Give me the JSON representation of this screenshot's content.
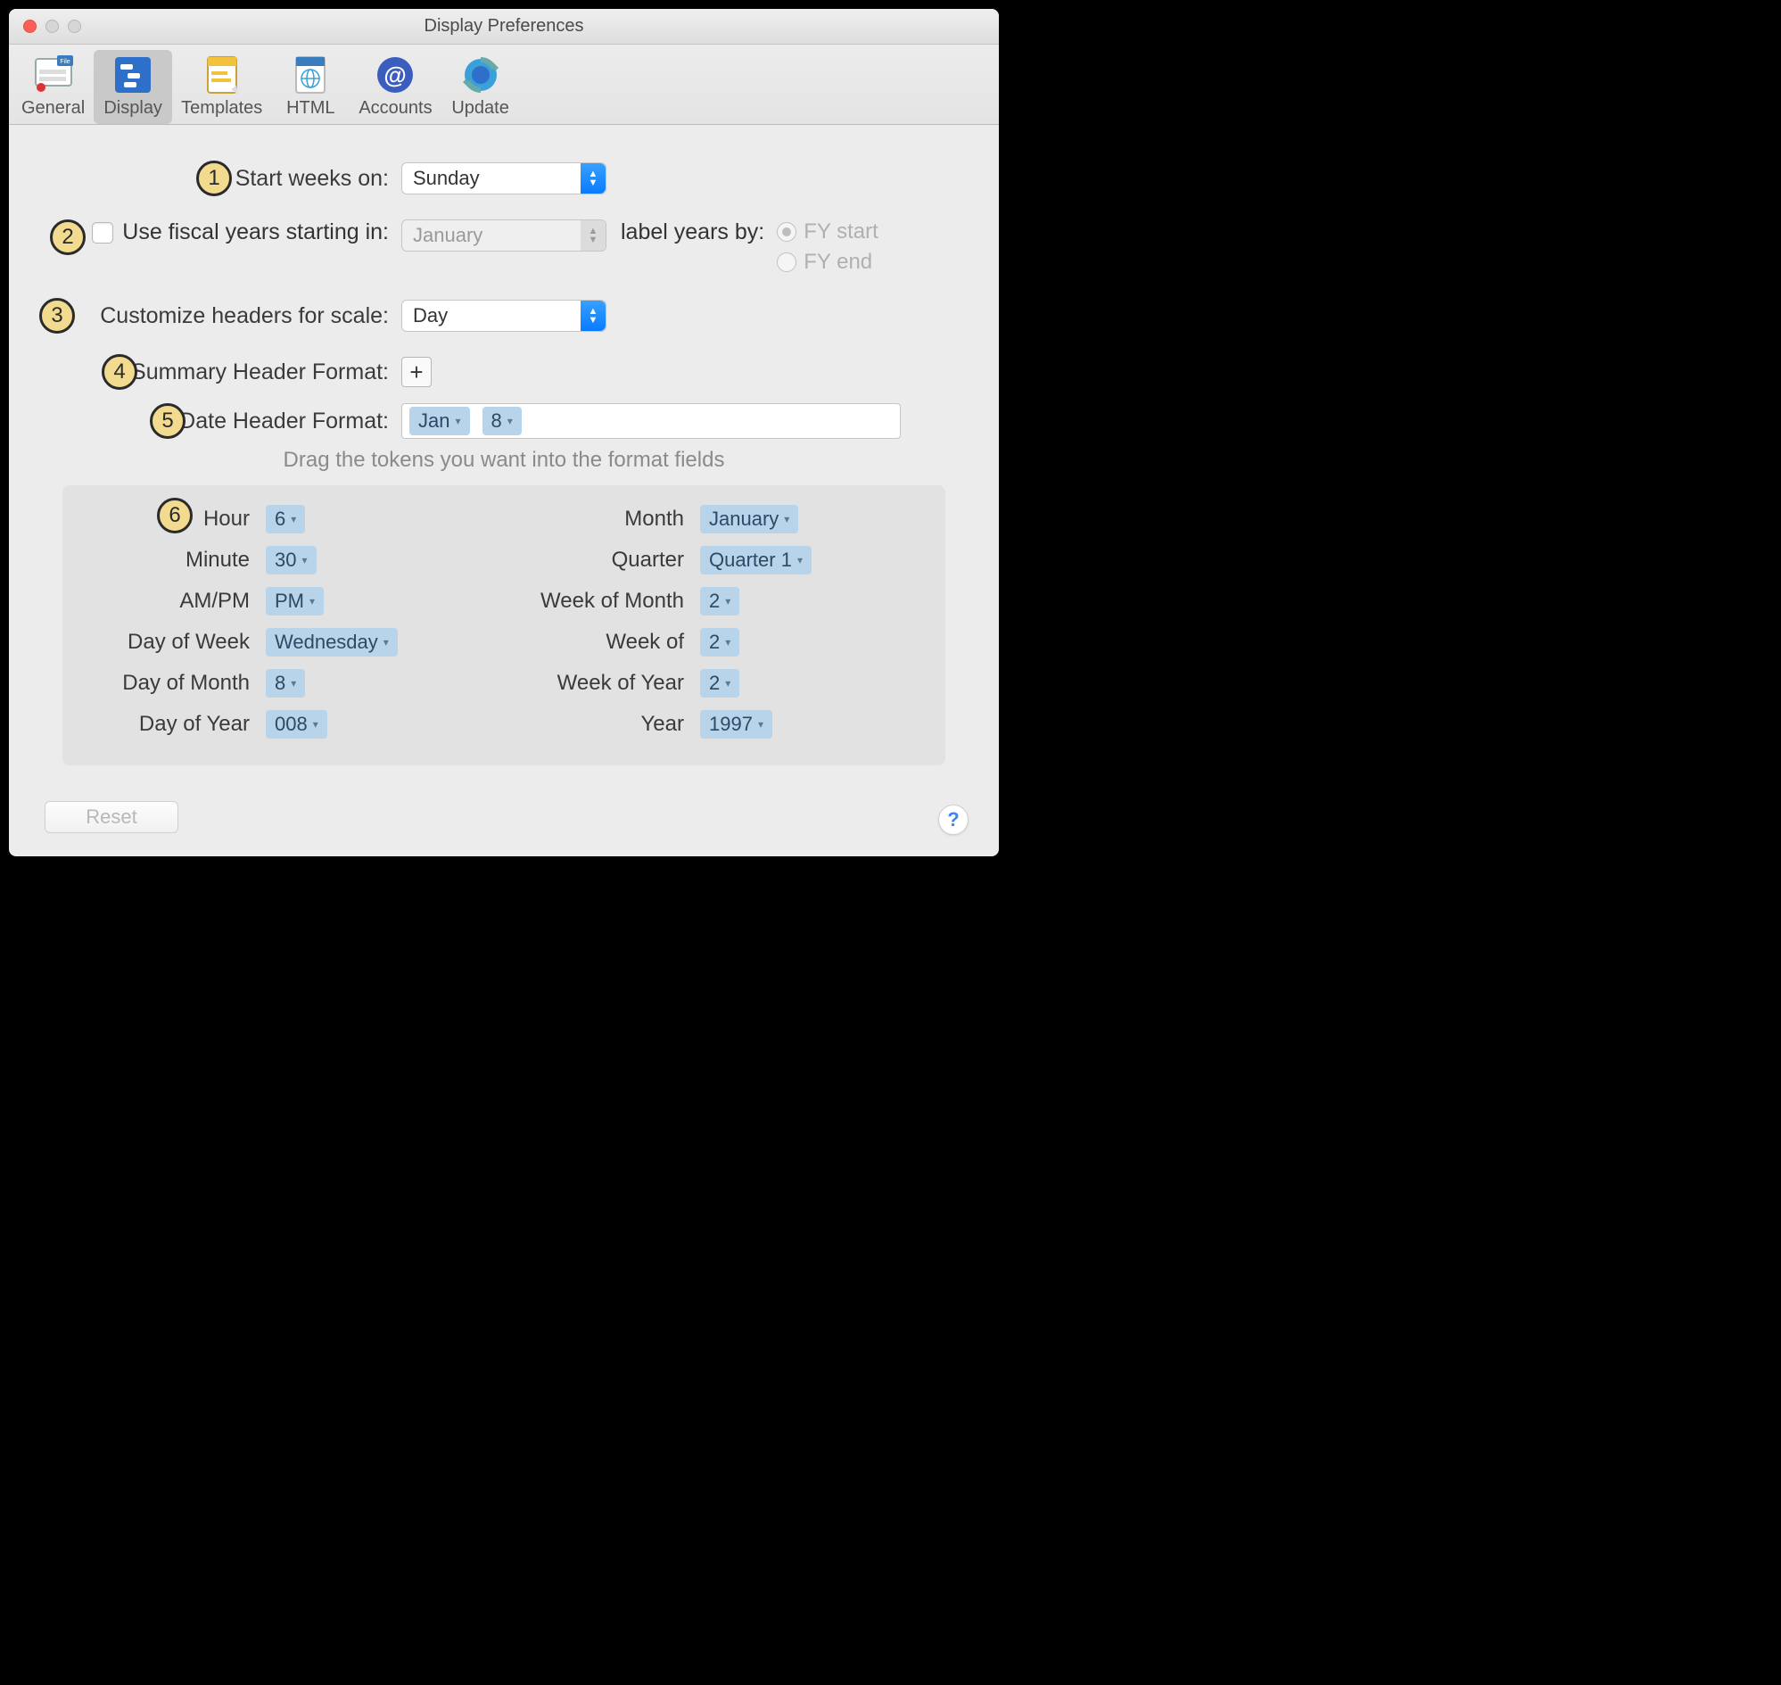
{
  "window": {
    "title": "Display Preferences"
  },
  "toolbar": {
    "items": [
      {
        "label": "General"
      },
      {
        "label": "Display"
      },
      {
        "label": "Templates"
      },
      {
        "label": "HTML"
      },
      {
        "label": "Accounts"
      },
      {
        "label": "Update"
      }
    ]
  },
  "callouts": {
    "c1": "1",
    "c2": "2",
    "c3": "3",
    "c4": "4",
    "c5": "5",
    "c6": "6"
  },
  "row1": {
    "label": "Start weeks on:",
    "value": "Sunday"
  },
  "row2": {
    "checkbox_label": "Use fiscal years starting in:",
    "month": "January",
    "label_years_by": "label years by:",
    "fy_start": "FY start",
    "fy_end": "FY end"
  },
  "row3": {
    "label": "Customize headers for scale:",
    "value": "Day"
  },
  "row4": {
    "label": "Summary Header Format:",
    "plus": "+"
  },
  "row5": {
    "label": "Date Header Format:",
    "tokens": [
      "Jan",
      "8"
    ]
  },
  "hint": "Drag the tokens you want into the format fields",
  "tokens": {
    "left": [
      {
        "label": "Hour",
        "value": "6"
      },
      {
        "label": "Minute",
        "value": "30"
      },
      {
        "label": "AM/PM",
        "value": "PM"
      },
      {
        "label": "Day of Week",
        "value": "Wednesday"
      },
      {
        "label": "Day of Month",
        "value": "8"
      },
      {
        "label": "Day of Year",
        "value": "008"
      }
    ],
    "right": [
      {
        "label": "Month",
        "value": "January"
      },
      {
        "label": "Quarter",
        "value": "Quarter 1"
      },
      {
        "label": "Week of Month",
        "value": "2"
      },
      {
        "label": "Week of",
        "value": "2"
      },
      {
        "label": "Week of Year",
        "value": "2"
      },
      {
        "label": "Year",
        "value": "1997"
      }
    ]
  },
  "reset": "Reset",
  "help": "?"
}
